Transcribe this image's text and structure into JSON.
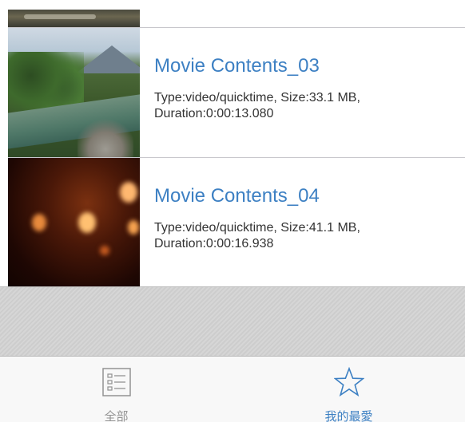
{
  "videos": [
    {
      "title": "Movie Contents_03",
      "description": "Type:video/quicktime, Size:33.1 MB, Duration:0:00:13.080",
      "thumbnail": "river-landscape-thumbnail"
    },
    {
      "title": "Movie Contents_04",
      "description": "Type:video/quicktime, Size:41.1 MB, Duration:0:00:16.938",
      "thumbnail": "bokeh-lights-thumbnail"
    }
  ],
  "tabbar": {
    "tabs": [
      {
        "label": "全部",
        "icon": "list-icon",
        "selected": false
      },
      {
        "label": "我的最愛",
        "icon": "star-icon",
        "selected": true
      }
    ]
  },
  "colors": {
    "accent": "#3d80c3",
    "tab_inactive": "#929292"
  }
}
